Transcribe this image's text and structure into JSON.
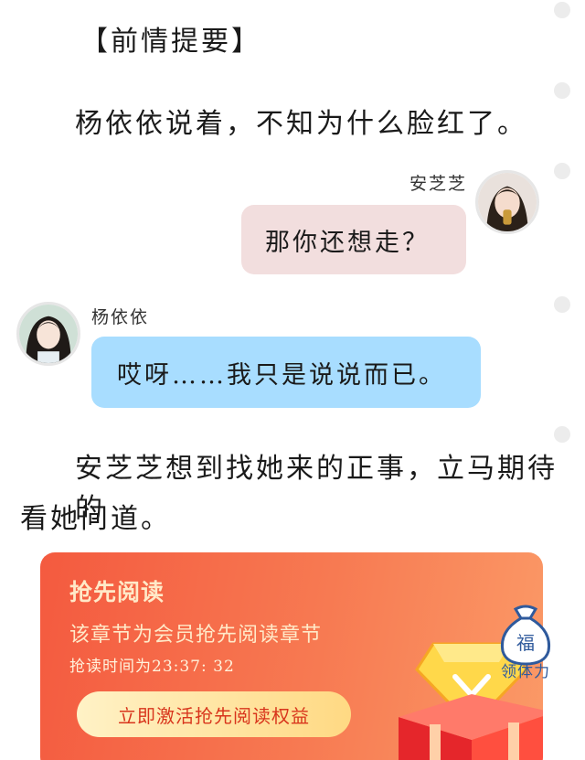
{
  "story": {
    "recap_heading": "【前情提要】",
    "narration_1": "杨依依说着，不知为什么脸红了。",
    "narration_2_line1": "安芝芝想到找她来的正事，立马期待的",
    "narration_2_line2": "看她问道。"
  },
  "chat": {
    "right": {
      "name": "安芝芝",
      "message": "那你还想走？",
      "bubble_color": "#f2dede"
    },
    "left": {
      "name": "杨依依",
      "message": "哎呀……我只是说说而已。",
      "bubble_color": "#a8ddff"
    }
  },
  "premium": {
    "title": "抢先阅读",
    "subtitle": "该章节为会员抢先阅读章节",
    "timer": "抢读时间为23:37: 32",
    "button_label": "立即激活抢先阅读权益",
    "card_color": "#f45a3f"
  },
  "reward": {
    "bag_glyph": "福",
    "label": "领体力"
  }
}
